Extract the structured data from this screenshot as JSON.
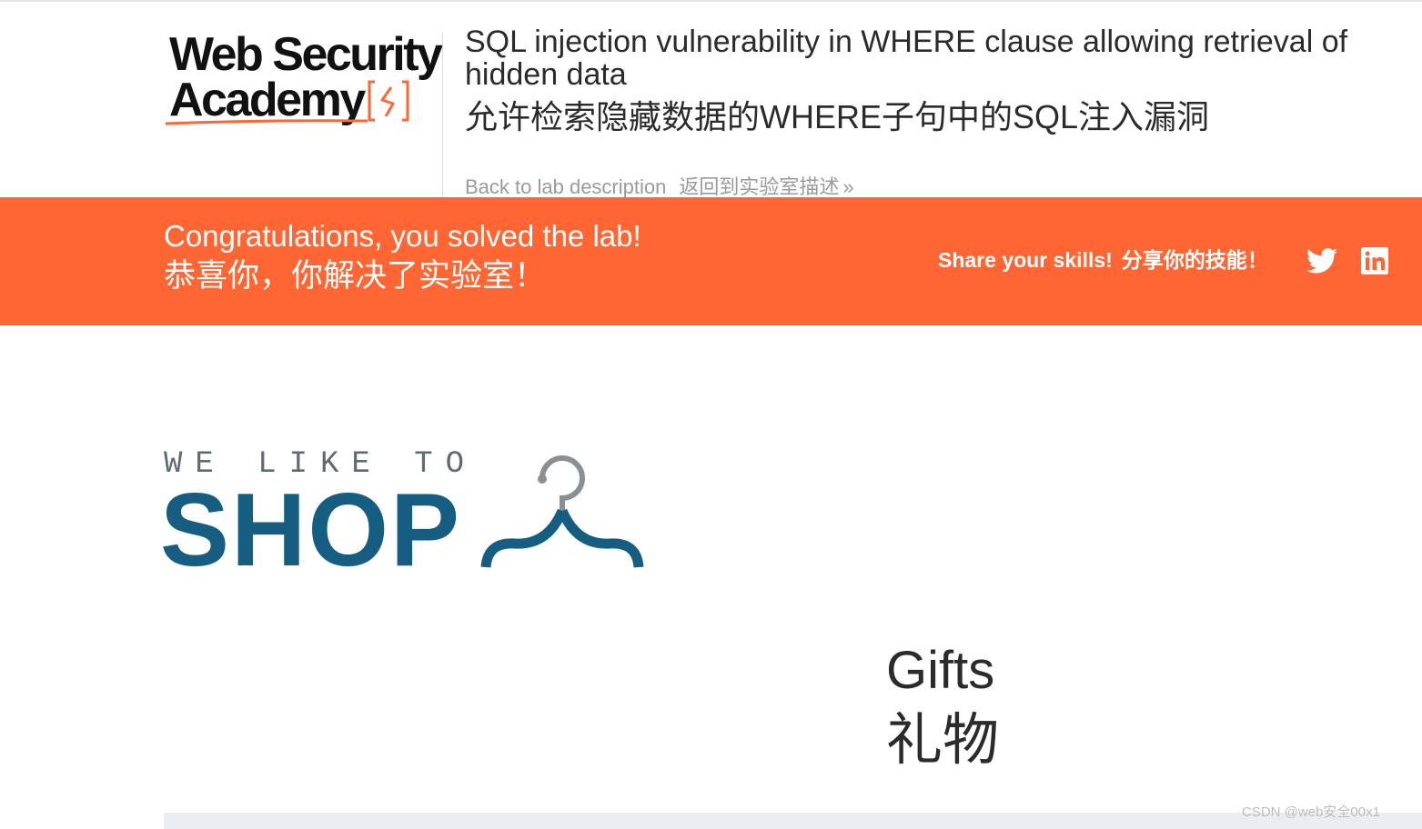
{
  "header": {
    "logo_line1": "Web Security",
    "logo_line2": "Academy",
    "lab_title_en": "SQL injection vulnerability in WHERE clause allowing retrieval of hidden data",
    "lab_title_zh": "允许检索隐藏数据的WHERE子句中的SQL注入漏洞",
    "back_link_en": "Back to lab description",
    "back_link_zh": "返回到实验室描述",
    "back_link_chevron": "»"
  },
  "banner": {
    "congrats_en": "Congratulations, you solved the lab!",
    "congrats_zh": "恭喜你，你解决了实验室！",
    "share_en": "Share your skills!",
    "share_zh": "分享你的技能！",
    "icons": [
      "twitter-icon",
      "linkedin-icon"
    ],
    "color": "#ff6633"
  },
  "shop": {
    "tagline": "WE LIKE TO",
    "word": "SHOP",
    "brand_color": "#155e82",
    "icon": "hanger-icon"
  },
  "category": {
    "title_en": "Gifts",
    "title_zh": "礼物"
  },
  "watermark": "CSDN @web安全00x1"
}
